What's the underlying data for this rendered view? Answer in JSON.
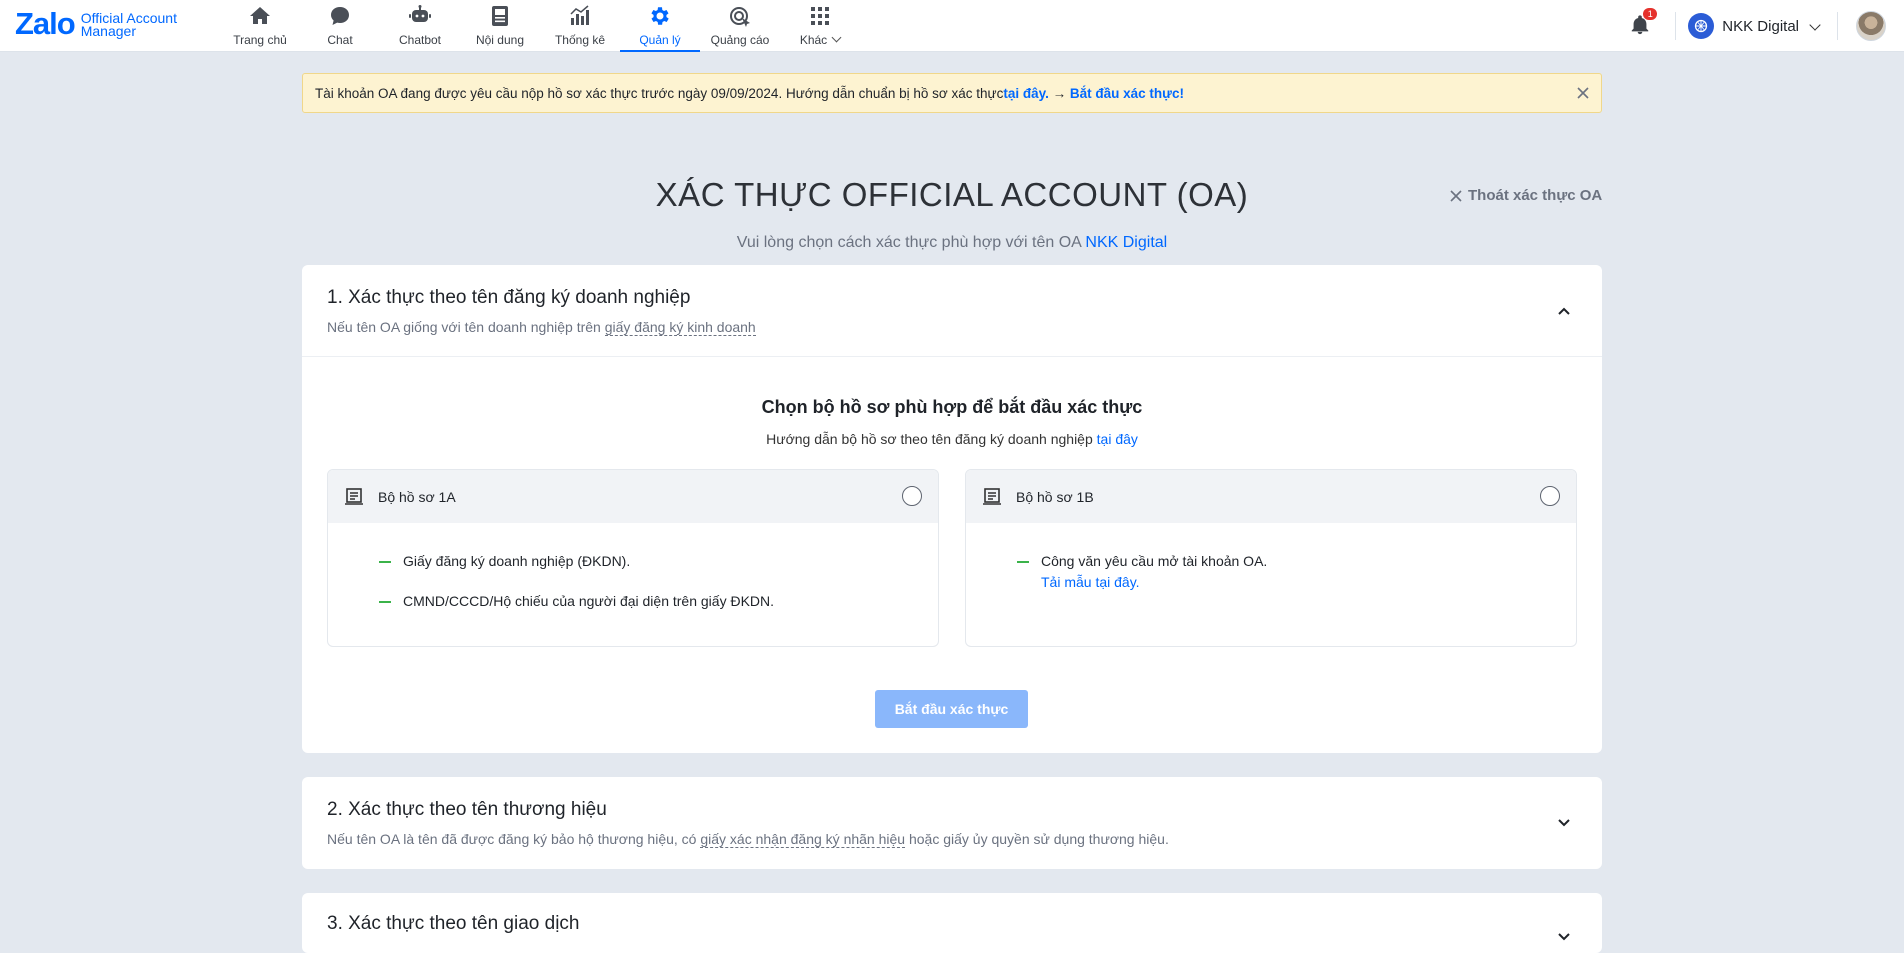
{
  "brand": {
    "logo_text": "Zalo",
    "logo_sub_line1": "Official Account",
    "logo_sub_line2": "Manager"
  },
  "nav": {
    "items": [
      {
        "label": "Trang chủ",
        "icon": "home-icon"
      },
      {
        "label": "Chat",
        "icon": "chat-icon"
      },
      {
        "label": "Chatbot",
        "icon": "chatbot-icon"
      },
      {
        "label": "Nội dung",
        "icon": "content-icon"
      },
      {
        "label": "Thống kê",
        "icon": "stats-icon"
      },
      {
        "label": "Quản lý",
        "icon": "gear-icon",
        "active": true
      },
      {
        "label": "Quảng cáo",
        "icon": "ads-icon"
      },
      {
        "label": "Khác",
        "icon": "grid-icon"
      }
    ]
  },
  "header": {
    "notification_count": "1",
    "account_name": "NKK Digital"
  },
  "banner": {
    "text": "Tài khoản OA đang được yêu cầu nộp hồ sơ xác thực trước ngày 09/09/2024. Hướng dẫn chuẩn bị hồ sơ xác thực ",
    "link_here": "tại đây.",
    "arrow": " → ",
    "link_start": "Bắt đầu xác thực!"
  },
  "page": {
    "title": "XÁC THỰC OFFICIAL ACCOUNT (OA)",
    "exit_label": "Thoát xác thực OA",
    "subtitle_prefix": "Vui lòng chọn cách xác thực phù hợp với tên OA ",
    "subtitle_oa": "NKK Digital"
  },
  "section1": {
    "title": "1. Xác thực theo tên đăng ký doanh nghiệp",
    "desc_prefix": "Nếu tên OA giống với tên doanh nghiệp trên ",
    "desc_link": "giấy đăng ký kinh doanh",
    "choose_title": "Chọn bộ hồ sơ phù hợp để bắt đầu xác thực",
    "choose_sub_prefix": "Hướng dẫn bộ hồ sơ theo tên đăng ký doanh nghiệp ",
    "choose_sub_link": "tại đây",
    "option_a": {
      "name": "Bộ hồ sơ 1A",
      "req1": "Giấy đăng ký doanh nghiệp (ĐKDN).",
      "req2": "CMND/CCCD/Hộ chiếu của người đại diện trên giấy ĐKDN."
    },
    "option_b": {
      "name": "Bộ hồ sơ 1B",
      "req1": "Công văn yêu cầu mở tài khoản OA.",
      "req1_link": "Tải mẫu tại đây."
    },
    "start_button": "Bắt đầu xác thực"
  },
  "section2": {
    "title": "2. Xác thực theo tên thương hiệu",
    "desc_prefix": "Nếu tên OA là tên đã được đăng ký bảo hộ thương hiệu, có ",
    "desc_link": "giấy xác nhận đăng ký nhãn hiệu",
    "desc_suffix": " hoặc giấy ủy quyền sử dụng thương hiệu."
  },
  "section3": {
    "title": "3. Xác thực theo tên giao dịch"
  },
  "colors": {
    "accent": "#0068ff",
    "banner_bg": "#fdf3d1",
    "page_bg": "#e3e8ef",
    "button_disabled": "#8ab7fb",
    "bullet": "#3bb34a"
  }
}
